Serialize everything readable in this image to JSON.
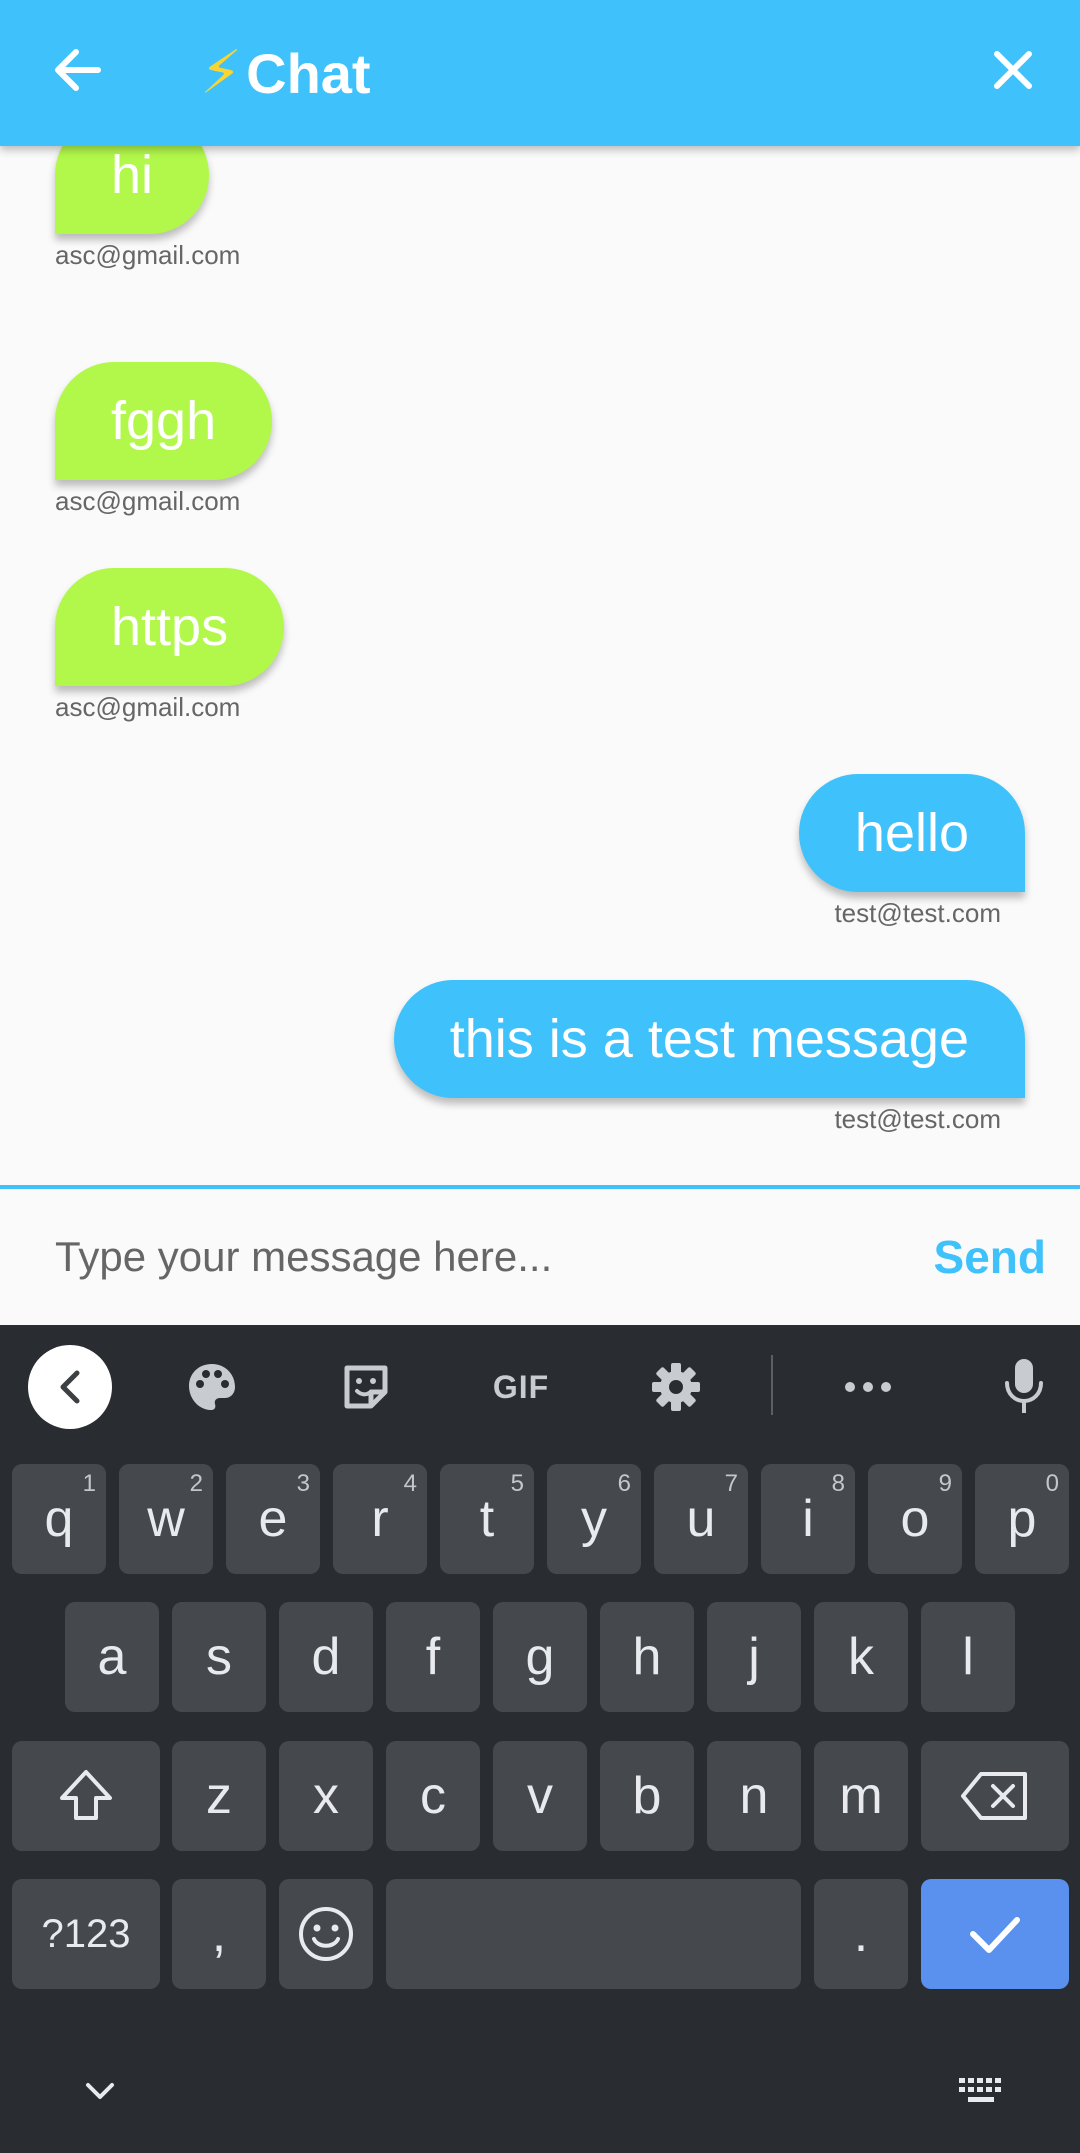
{
  "app": {
    "title": "Chat",
    "bolt_glyph": "⚡"
  },
  "messages": [
    {
      "text": "hi",
      "sender": "asc@gmail.com",
      "side": "left"
    },
    {
      "text": "fggh",
      "sender": "asc@gmail.com",
      "side": "left"
    },
    {
      "text": "https",
      "sender": "asc@gmail.com",
      "side": "left"
    },
    {
      "text": "hello",
      "sender": "test@test.com",
      "side": "right"
    },
    {
      "text": "this is a  test message",
      "sender": "test@test.com",
      "side": "right"
    }
  ],
  "composer": {
    "placeholder": "Type your message here...",
    "value": "",
    "send_label": "Send"
  },
  "keyboard": {
    "toolbar": {
      "gif_label": "GIF"
    },
    "row1": [
      {
        "k": "q",
        "h": "1"
      },
      {
        "k": "w",
        "h": "2"
      },
      {
        "k": "e",
        "h": "3"
      },
      {
        "k": "r",
        "h": "4"
      },
      {
        "k": "t",
        "h": "5"
      },
      {
        "k": "y",
        "h": "6"
      },
      {
        "k": "u",
        "h": "7"
      },
      {
        "k": "i",
        "h": "8"
      },
      {
        "k": "o",
        "h": "9"
      },
      {
        "k": "p",
        "h": "0"
      }
    ],
    "row2": [
      "a",
      "s",
      "d",
      "f",
      "g",
      "h",
      "j",
      "k",
      "l"
    ],
    "row3": [
      "z",
      "x",
      "c",
      "v",
      "b",
      "n",
      "m"
    ],
    "symbols_label": "?123",
    "comma": ",",
    "period": "."
  },
  "colors": {
    "primary": "#3fc1fb",
    "incoming": "#b2f84a",
    "keyboard_bg": "#292d31",
    "key_bg": "#45494e",
    "enter": "#5a90ee"
  }
}
